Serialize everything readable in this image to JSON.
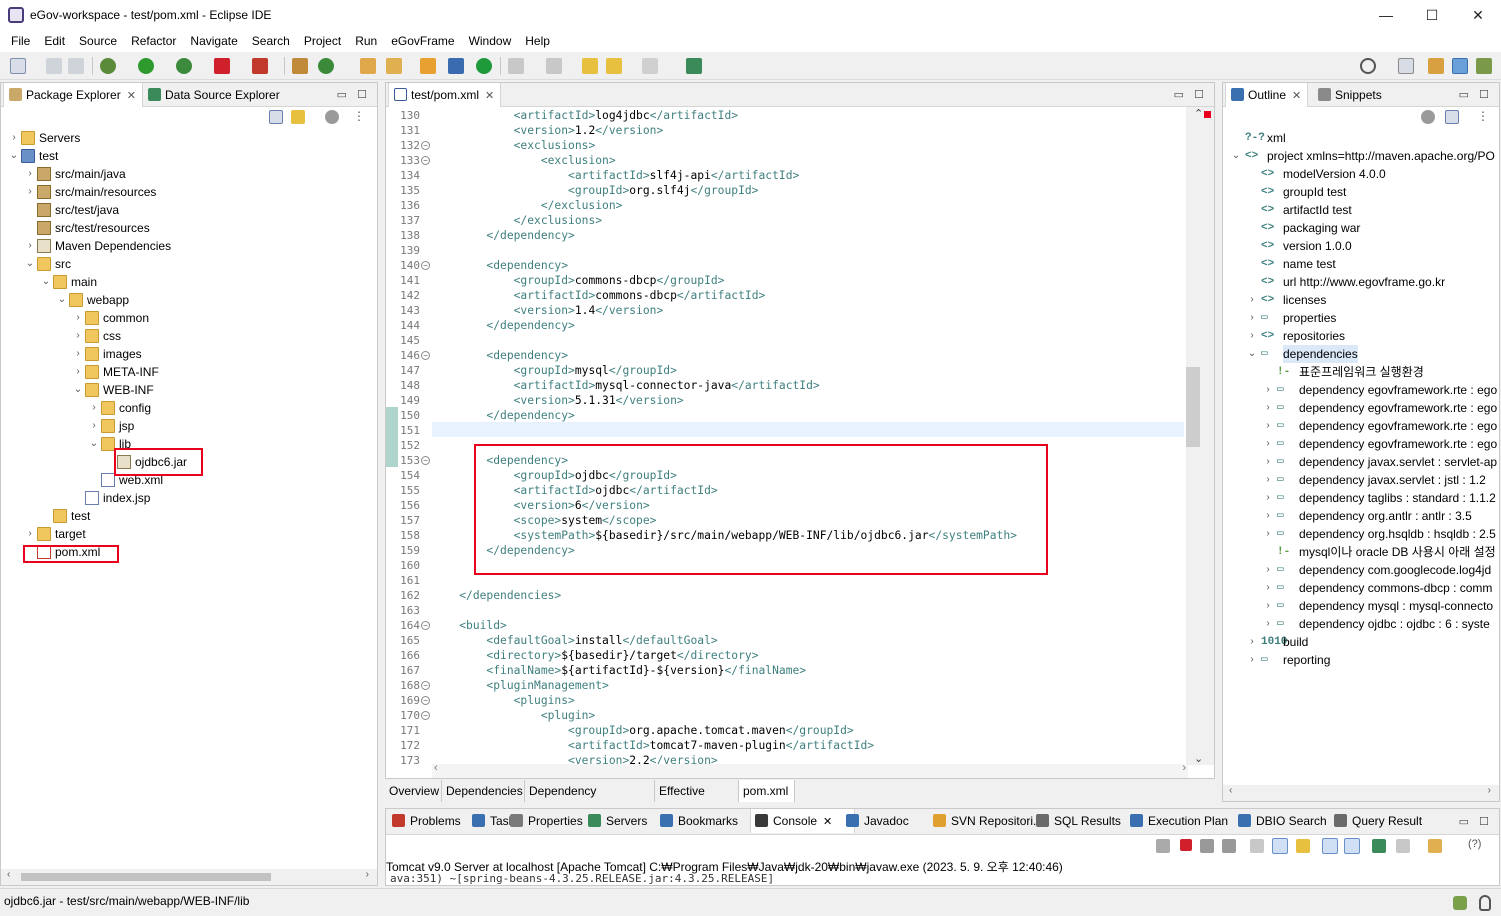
{
  "window": {
    "title": "eGov-workspace - test/pom.xml - Eclipse IDE",
    "minimize": "—",
    "maximize": "☐",
    "close": "✕"
  },
  "menu": [
    "File",
    "Edit",
    "Source",
    "Refactor",
    "Navigate",
    "Search",
    "Project",
    "Run",
    "eGovFrame",
    "Window",
    "Help"
  ],
  "left_tabs": {
    "package_explorer": "Package Explorer",
    "data_source_explorer": "Data Source Explorer"
  },
  "package_tree": [
    {
      "label": "Servers",
      "depth": 0,
      "arrow": "›",
      "icon": "folder"
    },
    {
      "label": "test",
      "depth": 0,
      "arrow": "⌄",
      "icon": "project"
    },
    {
      "label": "src/main/java",
      "depth": 1,
      "arrow": "›",
      "icon": "package"
    },
    {
      "label": "src/main/resources",
      "depth": 1,
      "arrow": "›",
      "icon": "package"
    },
    {
      "label": "src/test/java",
      "depth": 1,
      "arrow": "",
      "icon": "package"
    },
    {
      "label": "src/test/resources",
      "depth": 1,
      "arrow": "",
      "icon": "package"
    },
    {
      "label": "Maven Dependencies",
      "depth": 1,
      "arrow": "›",
      "icon": "jar-library"
    },
    {
      "label": "src",
      "depth": 1,
      "arrow": "⌄",
      "icon": "folder"
    },
    {
      "label": "main",
      "depth": 2,
      "arrow": "⌄",
      "icon": "folder"
    },
    {
      "label": "webapp",
      "depth": 3,
      "arrow": "⌄",
      "icon": "folder"
    },
    {
      "label": "common",
      "depth": 4,
      "arrow": "›",
      "icon": "folder"
    },
    {
      "label": "css",
      "depth": 4,
      "arrow": "›",
      "icon": "folder"
    },
    {
      "label": "images",
      "depth": 4,
      "arrow": "›",
      "icon": "folder"
    },
    {
      "label": "META-INF",
      "depth": 4,
      "arrow": "›",
      "icon": "folder"
    },
    {
      "label": "WEB-INF",
      "depth": 4,
      "arrow": "⌄",
      "icon": "folder"
    },
    {
      "label": "config",
      "depth": 5,
      "arrow": "›",
      "icon": "folder"
    },
    {
      "label": "jsp",
      "depth": 5,
      "arrow": "›",
      "icon": "folder"
    },
    {
      "label": "lib",
      "depth": 5,
      "arrow": "⌄",
      "icon": "folder"
    },
    {
      "label": "ojdbc6.jar",
      "depth": 6,
      "arrow": "",
      "icon": "jar"
    },
    {
      "label": "web.xml",
      "depth": 5,
      "arrow": "",
      "icon": "xml"
    },
    {
      "label": "index.jsp",
      "depth": 4,
      "arrow": "",
      "icon": "file"
    },
    {
      "label": "test",
      "depth": 2,
      "arrow": "",
      "icon": "folder"
    },
    {
      "label": "target",
      "depth": 1,
      "arrow": "›",
      "icon": "folder"
    },
    {
      "label": "pom.xml",
      "depth": 1,
      "arrow": "",
      "icon": "pom"
    }
  ],
  "editor": {
    "tab": "test/pom.xml",
    "line_numbers": [
      "130",
      "131",
      "132",
      "133",
      "134",
      "135",
      "136",
      "137",
      "138",
      "139",
      "140",
      "141",
      "142",
      "143",
      "144",
      "145",
      "146",
      "147",
      "148",
      "149",
      "150",
      "151",
      "152",
      "153",
      "154",
      "155",
      "156",
      "157",
      "158",
      "159",
      "160",
      "161",
      "162",
      "163",
      "164",
      "165",
      "166",
      "167",
      "168",
      "169",
      "170",
      "171",
      "172",
      "173"
    ],
    "fold_lines": [
      "132",
      "133",
      "140",
      "146",
      "153",
      "164",
      "168",
      "169",
      "170"
    ],
    "lines": [
      "            <artifactId>log4jdbc</artifactId>",
      "            <version>1.2</version>",
      "            <exclusions>",
      "                <exclusion>",
      "                    <artifactId>slf4j-api</artifactId>",
      "                    <groupId>org.slf4j</groupId>",
      "                </exclusion>",
      "            </exclusions>",
      "        </dependency>",
      "",
      "        <dependency>",
      "            <groupId>commons-dbcp</groupId>",
      "            <artifactId>commons-dbcp</artifactId>",
      "            <version>1.4</version>",
      "        </dependency>",
      "",
      "        <dependency>",
      "            <groupId>mysql</groupId>",
      "            <artifactId>mysql-connector-java</artifactId>",
      "            <version>5.1.31</version>",
      "        </dependency>",
      "",
      "",
      "        <dependency>",
      "            <groupId>ojdbc</groupId>",
      "            <artifactId>ojdbc</artifactId>",
      "            <version>6</version>",
      "            <scope>system</scope>",
      "            <systemPath>${basedir}/src/main/webapp/WEB-INF/lib/ojdbc6.jar</systemPath>",
      "        </dependency>",
      "",
      "",
      "    </dependencies>",
      "",
      "    <build>",
      "        <defaultGoal>install</defaultGoal>",
      "        <directory>${basedir}/target</directory>",
      "        <finalName>${artifactId}-${version}</finalName>",
      "        <pluginManagement>",
      "            <plugins>",
      "                <plugin>",
      "                    <groupId>org.apache.tomcat.maven</groupId>",
      "                    <artifactId>tomcat7-maven-plugin</artifactId>",
      "                    <version>2.2</version>"
    ],
    "bottom_tabs": [
      "Overview",
      "Dependencies",
      "Dependency Hierarchy",
      "Effective POM",
      "pom.xml"
    ]
  },
  "outline_tabs": {
    "outline": "Outline",
    "snippets": "Snippets"
  },
  "outline": [
    {
      "tag": "?-?",
      "text": "xml",
      "depth": 0,
      "arrow": ""
    },
    {
      "tag": "<>",
      "text": "project xmlns=http://maven.apache.org/PO",
      "depth": 0,
      "arrow": "⌄"
    },
    {
      "tag": "<>",
      "text": "modelVersion  4.0.0",
      "depth": 1,
      "arrow": ""
    },
    {
      "tag": "<>",
      "text": "groupId  test",
      "depth": 1,
      "arrow": ""
    },
    {
      "tag": "<>",
      "text": "artifactId  test",
      "depth": 1,
      "arrow": ""
    },
    {
      "tag": "<>",
      "text": "packaging  war",
      "depth": 1,
      "arrow": ""
    },
    {
      "tag": "<>",
      "text": "version  1.0.0",
      "depth": 1,
      "arrow": ""
    },
    {
      "tag": "<>",
      "text": "name  test",
      "depth": 1,
      "arrow": ""
    },
    {
      "tag": "<>",
      "text": "url  http://www.egovframe.go.kr",
      "depth": 1,
      "arrow": ""
    },
    {
      "tag": "<>",
      "text": "licenses",
      "depth": 1,
      "arrow": "›"
    },
    {
      "tag": "▭",
      "text": "properties",
      "depth": 1,
      "arrow": "›"
    },
    {
      "tag": "<>",
      "text": "repositories",
      "depth": 1,
      "arrow": "›"
    },
    {
      "tag": "▭",
      "text": "dependencies",
      "depth": 1,
      "arrow": "⌄"
    },
    {
      "tag": "!-",
      "text": "표준프레임워크 실행환경",
      "depth": 2,
      "arrow": ""
    },
    {
      "tag": "▭",
      "text": "dependency  egovframework.rte : ego",
      "depth": 2,
      "arrow": "›"
    },
    {
      "tag": "▭",
      "text": "dependency  egovframework.rte : ego",
      "depth": 2,
      "arrow": "›"
    },
    {
      "tag": "▭",
      "text": "dependency  egovframework.rte : ego",
      "depth": 2,
      "arrow": "›"
    },
    {
      "tag": "▭",
      "text": "dependency  egovframework.rte : ego",
      "depth": 2,
      "arrow": "›"
    },
    {
      "tag": "▭",
      "text": "dependency  javax.servlet : servlet-ap",
      "depth": 2,
      "arrow": "›"
    },
    {
      "tag": "▭",
      "text": "dependency  javax.servlet : jstl : 1.2",
      "depth": 2,
      "arrow": "›"
    },
    {
      "tag": "▭",
      "text": "dependency  taglibs : standard : 1.1.2",
      "depth": 2,
      "arrow": "›"
    },
    {
      "tag": "▭",
      "text": "dependency  org.antlr : antlr : 3.5",
      "depth": 2,
      "arrow": "›"
    },
    {
      "tag": "▭",
      "text": "dependency  org.hsqldb : hsqldb : 2.5",
      "depth": 2,
      "arrow": "›"
    },
    {
      "tag": "!-",
      "text": "mysql이나 oracle DB 사용시 아래 설정",
      "depth": 2,
      "arrow": ""
    },
    {
      "tag": "▭",
      "text": "dependency  com.googlecode.log4jd",
      "depth": 2,
      "arrow": "›"
    },
    {
      "tag": "▭",
      "text": "dependency  commons-dbcp : comm",
      "depth": 2,
      "arrow": "›"
    },
    {
      "tag": "▭",
      "text": "dependency  mysql : mysql-connecto",
      "depth": 2,
      "arrow": "›"
    },
    {
      "tag": "▭",
      "text": "dependency  ojdbc : ojdbc : 6 : syste",
      "depth": 2,
      "arrow": "›"
    },
    {
      "tag": "1010",
      "text": "build",
      "depth": 1,
      "arrow": "›"
    },
    {
      "tag": "▭",
      "text": "reporting",
      "depth": 1,
      "arrow": "›"
    }
  ],
  "console_tabs": [
    "Problems",
    "Tasks",
    "Properties",
    "Servers",
    "Bookmarks",
    "Console",
    "Javadoc",
    "SVN Repositori...",
    "SQL Results",
    "Execution Plan",
    "DBIO Search",
    "Query Result"
  ],
  "console": {
    "header": "Tomcat v9.0 Server at localhost [Apache Tomcat] C:₩Program Files₩Java₩jdk-20₩bin₩javaw.exe  (2023. 5. 9. 오후 12:40:46)",
    "line": "ava:351) ~[spring-beans-4.3.25.RELEASE.jar:4.3.25.RELEASE]"
  },
  "status": "ojdbc6.jar - test/src/main/webapp/WEB-INF/lib",
  "colors": {
    "tag": "#3f7f7f",
    "highlight_box": "#e8001c",
    "current_line": "#e8f2fe"
  }
}
